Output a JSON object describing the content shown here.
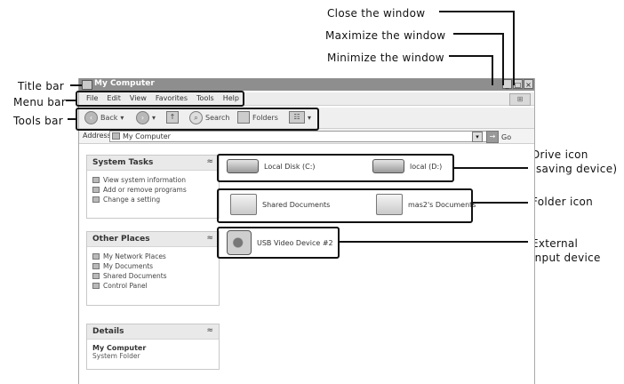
{
  "annotations": {
    "close": "Close the window",
    "maximize": "Maximize the window",
    "minimize": "Minimize the window",
    "title_bar": "Title bar",
    "menu_bar": "Menu bar",
    "tools_bar": "Tools bar",
    "drive_icon_1": "Drive icon",
    "drive_icon_2": "(saving device)",
    "folder_icon": "Folder icon",
    "external_1": "External",
    "external_2": "input device"
  },
  "window": {
    "title": "My Computer",
    "min_glyph": "_",
    "max_glyph": "□",
    "close_glyph": "×",
    "logo_glyph": "⊞"
  },
  "menu": [
    "File",
    "Edit",
    "View",
    "Favorites",
    "Tools",
    "Help"
  ],
  "toolbar": {
    "back": "Back",
    "search": "Search",
    "folders": "Folders",
    "views_glyph": "☷"
  },
  "address": {
    "label": "Address",
    "value": "My Computer",
    "go": "Go"
  },
  "sidebar": {
    "system_tasks": {
      "title": "System Tasks",
      "items": [
        "View system information",
        "Add or remove programs",
        "Change a setting"
      ]
    },
    "other_places": {
      "title": "Other Places",
      "items": [
        "My Network Places",
        "My Documents",
        "Shared Documents",
        "Control Panel"
      ]
    },
    "details": {
      "title": "Details",
      "name": "My Computer",
      "type": "System Folder"
    },
    "collapse_glyph": "≈"
  },
  "drives": [
    "Local Disk (C:)",
    "local (D:)"
  ],
  "folders": [
    "Shared Documents",
    "mas2's Documents"
  ],
  "devices": [
    "USB Video Device #2"
  ]
}
